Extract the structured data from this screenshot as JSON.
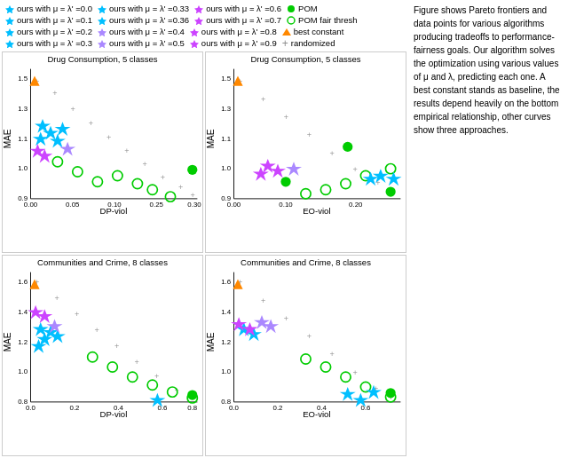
{
  "legend": {
    "items": [
      {
        "label": "ours with μ = λ' =0.0",
        "color": "#00bfff",
        "type": "star"
      },
      {
        "label": "ours with μ = λ' =0.33",
        "color": "#00bfff",
        "type": "star"
      },
      {
        "label": "ours with μ = λ' =0.6",
        "color": "#cc44ff",
        "type": "star"
      },
      {
        "label": "POM",
        "color": "#00cc00",
        "type": "circle-filled"
      },
      {
        "label": "ours with μ = λ' =0.1",
        "color": "#00bfff",
        "type": "star"
      },
      {
        "label": "ours with μ = λ' =0.36",
        "color": "#00bfff",
        "type": "star"
      },
      {
        "label": "ours with μ = λ' =0.7",
        "color": "#cc44ff",
        "type": "star"
      },
      {
        "label": "POM fair thresh",
        "color": "#00cc00",
        "type": "circle-open"
      },
      {
        "label": "ours with μ = λ' =0.2",
        "color": "#00bfff",
        "type": "star"
      },
      {
        "label": "ours with μ = λ' =0.4",
        "color": "#aa88ff",
        "type": "star"
      },
      {
        "label": "ours with μ = λ' =0.8",
        "color": "#cc44ff",
        "type": "star"
      },
      {
        "label": "best constant",
        "color": "#ff8800",
        "type": "triangle"
      },
      {
        "label": "ours with μ = λ' =0.3",
        "color": "#00bfff",
        "type": "star"
      },
      {
        "label": "ours with μ = λ' =0.5",
        "color": "#aa88ff",
        "type": "star"
      },
      {
        "label": "ours with μ = λ' =0.9",
        "color": "#cc44ff",
        "type": "star"
      },
      {
        "label": "randomized",
        "color": "#888888",
        "type": "plus"
      }
    ]
  },
  "charts": [
    {
      "title": "Drug Consumption, 5 classes",
      "xlabel": "DP-viol",
      "ylabel": "MAE",
      "xrange": [
        0.0,
        0.3
      ],
      "yrange": [
        0.85,
        1.55
      ],
      "id": "chart1"
    },
    {
      "title": "Drug Consumption, 5 classes",
      "xlabel": "EO-viol",
      "ylabel": "MAE",
      "xrange": [
        0.0,
        0.22
      ],
      "yrange": [
        0.85,
        1.55
      ],
      "id": "chart2"
    },
    {
      "title": "Communities and Crime, 8 classes",
      "xlabel": "DP-viol",
      "ylabel": "MAE",
      "xrange": [
        0.0,
        0.8
      ],
      "yrange": [
        0.75,
        1.75
      ],
      "id": "chart3"
    },
    {
      "title": "Communities and Crime, 8 classes",
      "xlabel": "EO-viol",
      "ylabel": "MAE",
      "xrange": [
        0.0,
        0.6
      ],
      "yrange": [
        0.75,
        1.75
      ],
      "id": "chart4"
    }
  ],
  "right_text": "Figure shows Pareto frontiers and data points for various algorithms producing tradeoffs to performance fairness goals. Our algorithm solves the optimization problem using various values of μ and λ, predicting each one. A best constant stands as baseline, the results depend heavily on the bottom of the empirical relationship, other curves show three approaches."
}
